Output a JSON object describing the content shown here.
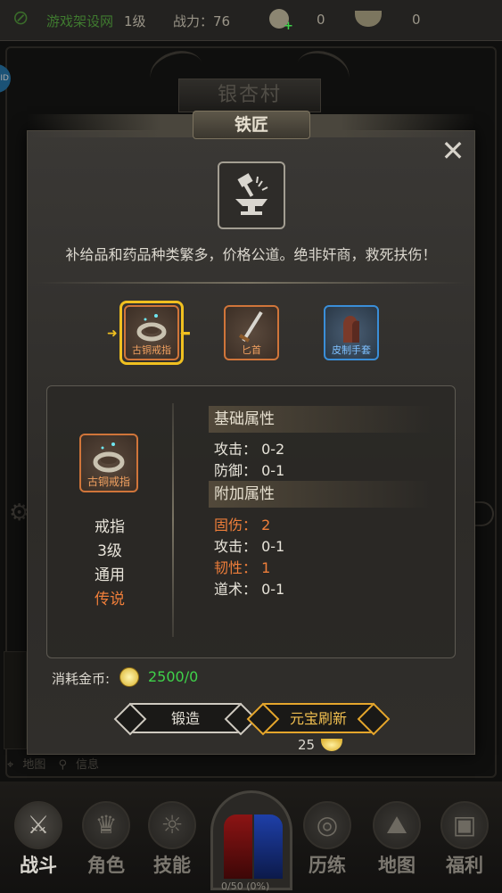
{
  "topbar": {
    "site": "游戏架设网",
    "level": "1级",
    "power": "战力：76",
    "copper": "0",
    "gold": "0"
  },
  "background": {
    "village": "银杏村",
    "side_badge": "ID",
    "bottom_links": [
      "地图",
      "信息"
    ]
  },
  "modal": {
    "title": "铁匠",
    "close_icon": "close-icon",
    "description": "补给品和药品种类繁多，价格公道。绝非奸商，救死扶伤！",
    "items": [
      {
        "name": "古铜戒指",
        "rarity": "orange"
      },
      {
        "name": "匕首",
        "rarity": "orange"
      },
      {
        "name": "皮制手套",
        "rarity": "blue"
      }
    ],
    "detail": {
      "item_name": "古铜戒指",
      "type": "戒指",
      "level": "3级",
      "class": "通用",
      "quality": "传说",
      "base_title": "基础属性",
      "base_attrs": [
        "攻击：  0-2",
        "防御：  0-1"
      ],
      "extra_title": "附加属性",
      "extra_attrs": [
        {
          "text": "固伤：  2",
          "highlight": true
        },
        {
          "text": "攻击：  0-1",
          "highlight": false
        },
        {
          "text": "韧性：  1",
          "highlight": true
        },
        {
          "text": "道术：  0-1",
          "highlight": false
        }
      ]
    },
    "cost_label": "消耗金币:",
    "cost_value": "2500/0",
    "forge_button": "锻造",
    "refresh_button": "元宝刷新",
    "refresh_cost": "25"
  },
  "bottom_nav": {
    "items": [
      {
        "label": "战斗",
        "icon": "crossed-swords-icon"
      },
      {
        "label": "角色",
        "icon": "character-icon"
      },
      {
        "label": "技能",
        "icon": "skill-icon"
      },
      {
        "label": "历练",
        "icon": "training-icon"
      },
      {
        "label": "地图",
        "icon": "map-icon"
      },
      {
        "label": "福利",
        "icon": "chest-icon"
      }
    ],
    "exp": "0/50 (0%)"
  },
  "colors": {
    "legend": "#ef7e3a",
    "cost_green": "#3fd24a",
    "select_gold": "#f0c020"
  }
}
